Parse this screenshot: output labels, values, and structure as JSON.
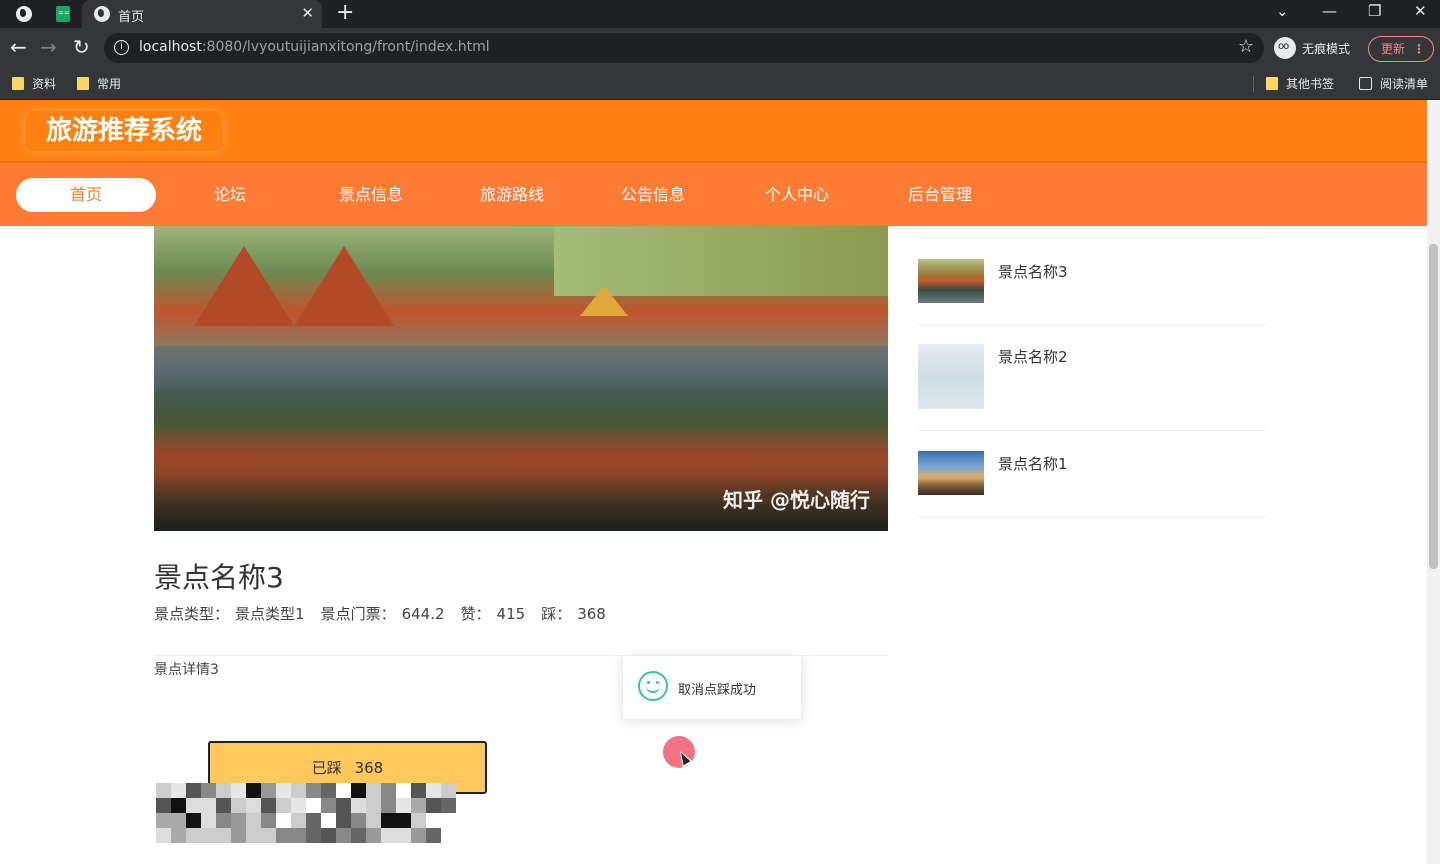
{
  "browser": {
    "tab_title": "首页",
    "url_host": "localhost",
    "url_rest": ":8080/lvyoutuijianxitong/front/index.html",
    "incognito_label": "无痕模式",
    "update_label": "更新",
    "bookmarks": [
      "资料",
      "常用"
    ],
    "other_bookmarks": "其他书签",
    "reading_list": "阅读清单"
  },
  "site": {
    "title": "旅游推荐系统",
    "nav": [
      "首页",
      "论坛",
      "景点信息",
      "旅游路线",
      "公告信息",
      "个人中心",
      "后台管理"
    ],
    "active_nav_index": 0
  },
  "hero": {
    "watermark": "知乎 @悦心随行"
  },
  "spot": {
    "name": "景点名称3",
    "type_label": "景点类型：",
    "type_value": "景点类型1",
    "ticket_label": "景点门票：",
    "ticket_value": "644.2",
    "like_label": "赞：",
    "like_value": "415",
    "tread_label": "踩：",
    "tread_value": "368",
    "detail": "景点详情3",
    "tread_button_label": "已踩",
    "tread_button_count": "368"
  },
  "toast": {
    "message": "取消点踩成功"
  },
  "sidebar": {
    "items": [
      {
        "name": "景点名称3"
      },
      {
        "name": "景点名称2"
      },
      {
        "name": "景点名称1"
      }
    ]
  },
  "colors": {
    "header": "#ff8012",
    "nav": "#fe7b35",
    "button": "#ffc85c",
    "toast_icon": "#35c98e"
  }
}
